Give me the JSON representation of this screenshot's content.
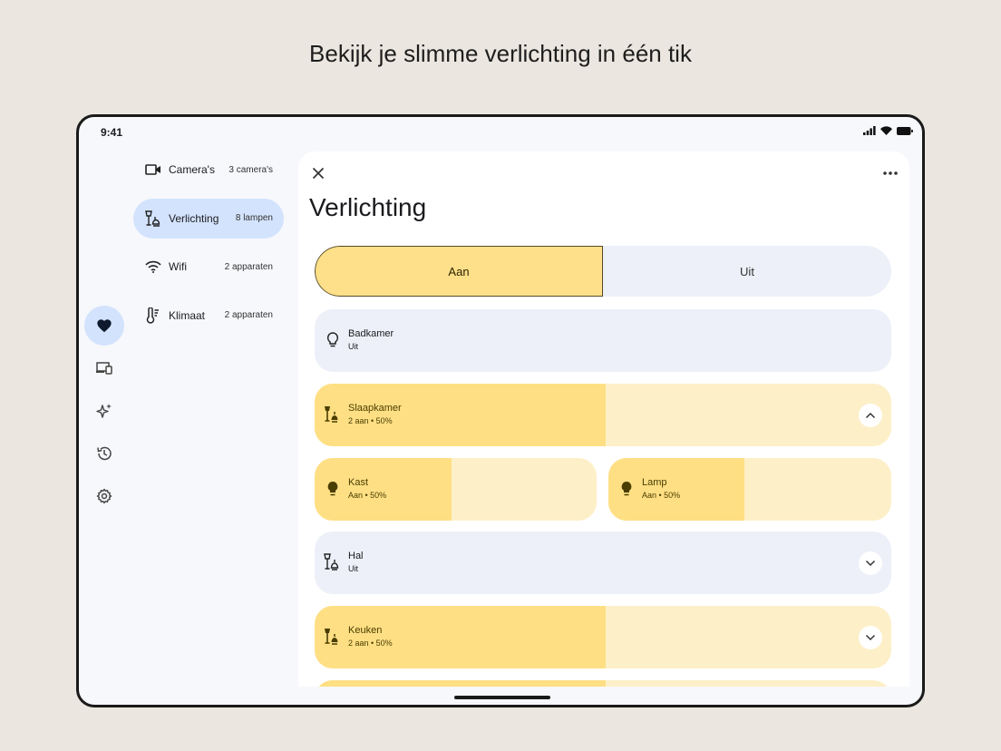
{
  "headline": "Bekijk je slimme verlichting in één tik",
  "status": {
    "time": "9:41"
  },
  "rail": [
    {
      "icon": "heart-icon",
      "active": true
    },
    {
      "icon": "devices-icon",
      "active": false
    },
    {
      "icon": "sparkle-icon",
      "active": false
    },
    {
      "icon": "history-icon",
      "active": false
    },
    {
      "icon": "settings-icon",
      "active": false
    }
  ],
  "nav": {
    "items": [
      {
        "label": "Camera's",
        "count": "3 camera's",
        "icon": "camera-icon"
      },
      {
        "label": "Verlichting",
        "count": "8 lampen",
        "icon": "lamp-icon",
        "active": true
      },
      {
        "label": "Wifi",
        "count": "2 apparaten",
        "icon": "wifi-icon"
      },
      {
        "label": "Klimaat",
        "count": "2 apparaten",
        "icon": "thermostat-icon"
      }
    ]
  },
  "panel": {
    "title": "Verlichting",
    "toggle": {
      "on_label": "Aan",
      "off_label": "Uit",
      "selected": "Aan"
    },
    "rooms": [
      {
        "name": "Badkamer",
        "status": "Uit",
        "icon": "bulb-icon"
      },
      {
        "name": "Slaapkamer",
        "status": "2 aan • 50%",
        "icon": "lamp-icon",
        "expanded": true,
        "level": 0.5
      },
      {
        "name": "Kast",
        "status": "Aan • 50%",
        "icon": "bulb-icon",
        "level": 0.5
      },
      {
        "name": "Lamp",
        "status": "Aan • 50%",
        "icon": "bulb-icon",
        "level": 0.5
      },
      {
        "name": "Hal",
        "status": "Uit",
        "icon": "lamp-icon",
        "expanded": false
      },
      {
        "name": "Keuken",
        "status": "2 aan • 50%",
        "icon": "lamp-icon",
        "expanded": false,
        "level": 0.5
      }
    ]
  },
  "colors": {
    "accent_on": "#fedf84",
    "tile_on_bg": "#fdefc8",
    "tile_off_bg": "#edf0f8",
    "nav_active": "#d3e3fd"
  }
}
